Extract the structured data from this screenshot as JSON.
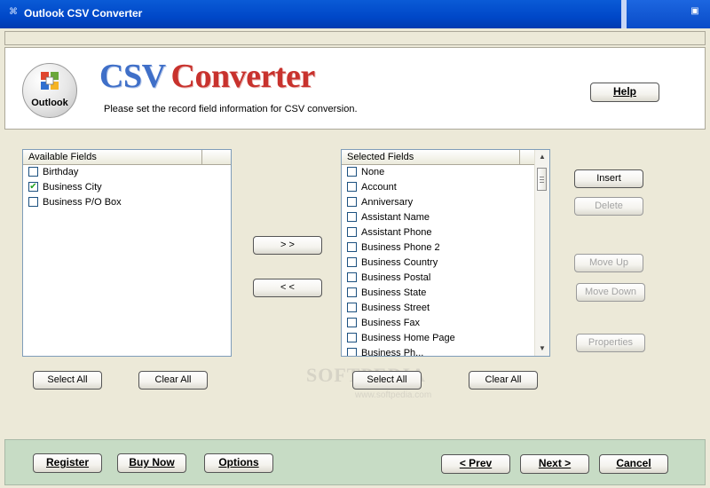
{
  "window": {
    "title": "Outlook CSV Converter"
  },
  "header": {
    "logo_text": "Outlook",
    "brand_part1": "CSV",
    "brand_part2": "Converter",
    "subtitle": "Please set the record field information for CSV conversion.",
    "help_label": "Help"
  },
  "available": {
    "header": "Available Fields",
    "items": [
      {
        "label": "Birthday",
        "checked": false
      },
      {
        "label": "Business City",
        "checked": true
      },
      {
        "label": "Business P/O Box",
        "checked": false
      }
    ],
    "select_all_label": "Select All",
    "clear_all_label": "Clear All"
  },
  "transfer": {
    "add_label": "> >",
    "remove_label": "< <"
  },
  "selected": {
    "header": "Selected Fields",
    "items": [
      {
        "label": "None"
      },
      {
        "label": "Account"
      },
      {
        "label": "Anniversary"
      },
      {
        "label": "Assistant Name"
      },
      {
        "label": "Assistant Phone"
      },
      {
        "label": "Business Phone 2"
      },
      {
        "label": "Business Country"
      },
      {
        "label": "Business Postal"
      },
      {
        "label": "Business State"
      },
      {
        "label": "Business Street"
      },
      {
        "label": "Business Fax"
      },
      {
        "label": "Business Home Page"
      },
      {
        "label": "Business Ph..."
      }
    ],
    "select_all_label": "Select All",
    "clear_all_label": "Clear All"
  },
  "actions": {
    "insert_label": "Insert",
    "delete_label": "Delete",
    "move_up_label": "Move Up",
    "move_down_label": "Move Down",
    "properties_label": "Properties"
  },
  "footer": {
    "register_label": "Register",
    "buy_now_label": "Buy Now",
    "options_label": "Options",
    "prev_label": "< Prev",
    "next_label": "Next >",
    "cancel_label": "Cancel"
  },
  "watermark": {
    "main": "SOFTPEDIA",
    "url": "www.softpedia.com"
  },
  "colors": {
    "title_bar": "#0a5bd6",
    "brand_blue": "#3f6fc8",
    "brand_red": "#c8322d",
    "footer_bg": "#c7dcc5",
    "check": "#21a121"
  }
}
